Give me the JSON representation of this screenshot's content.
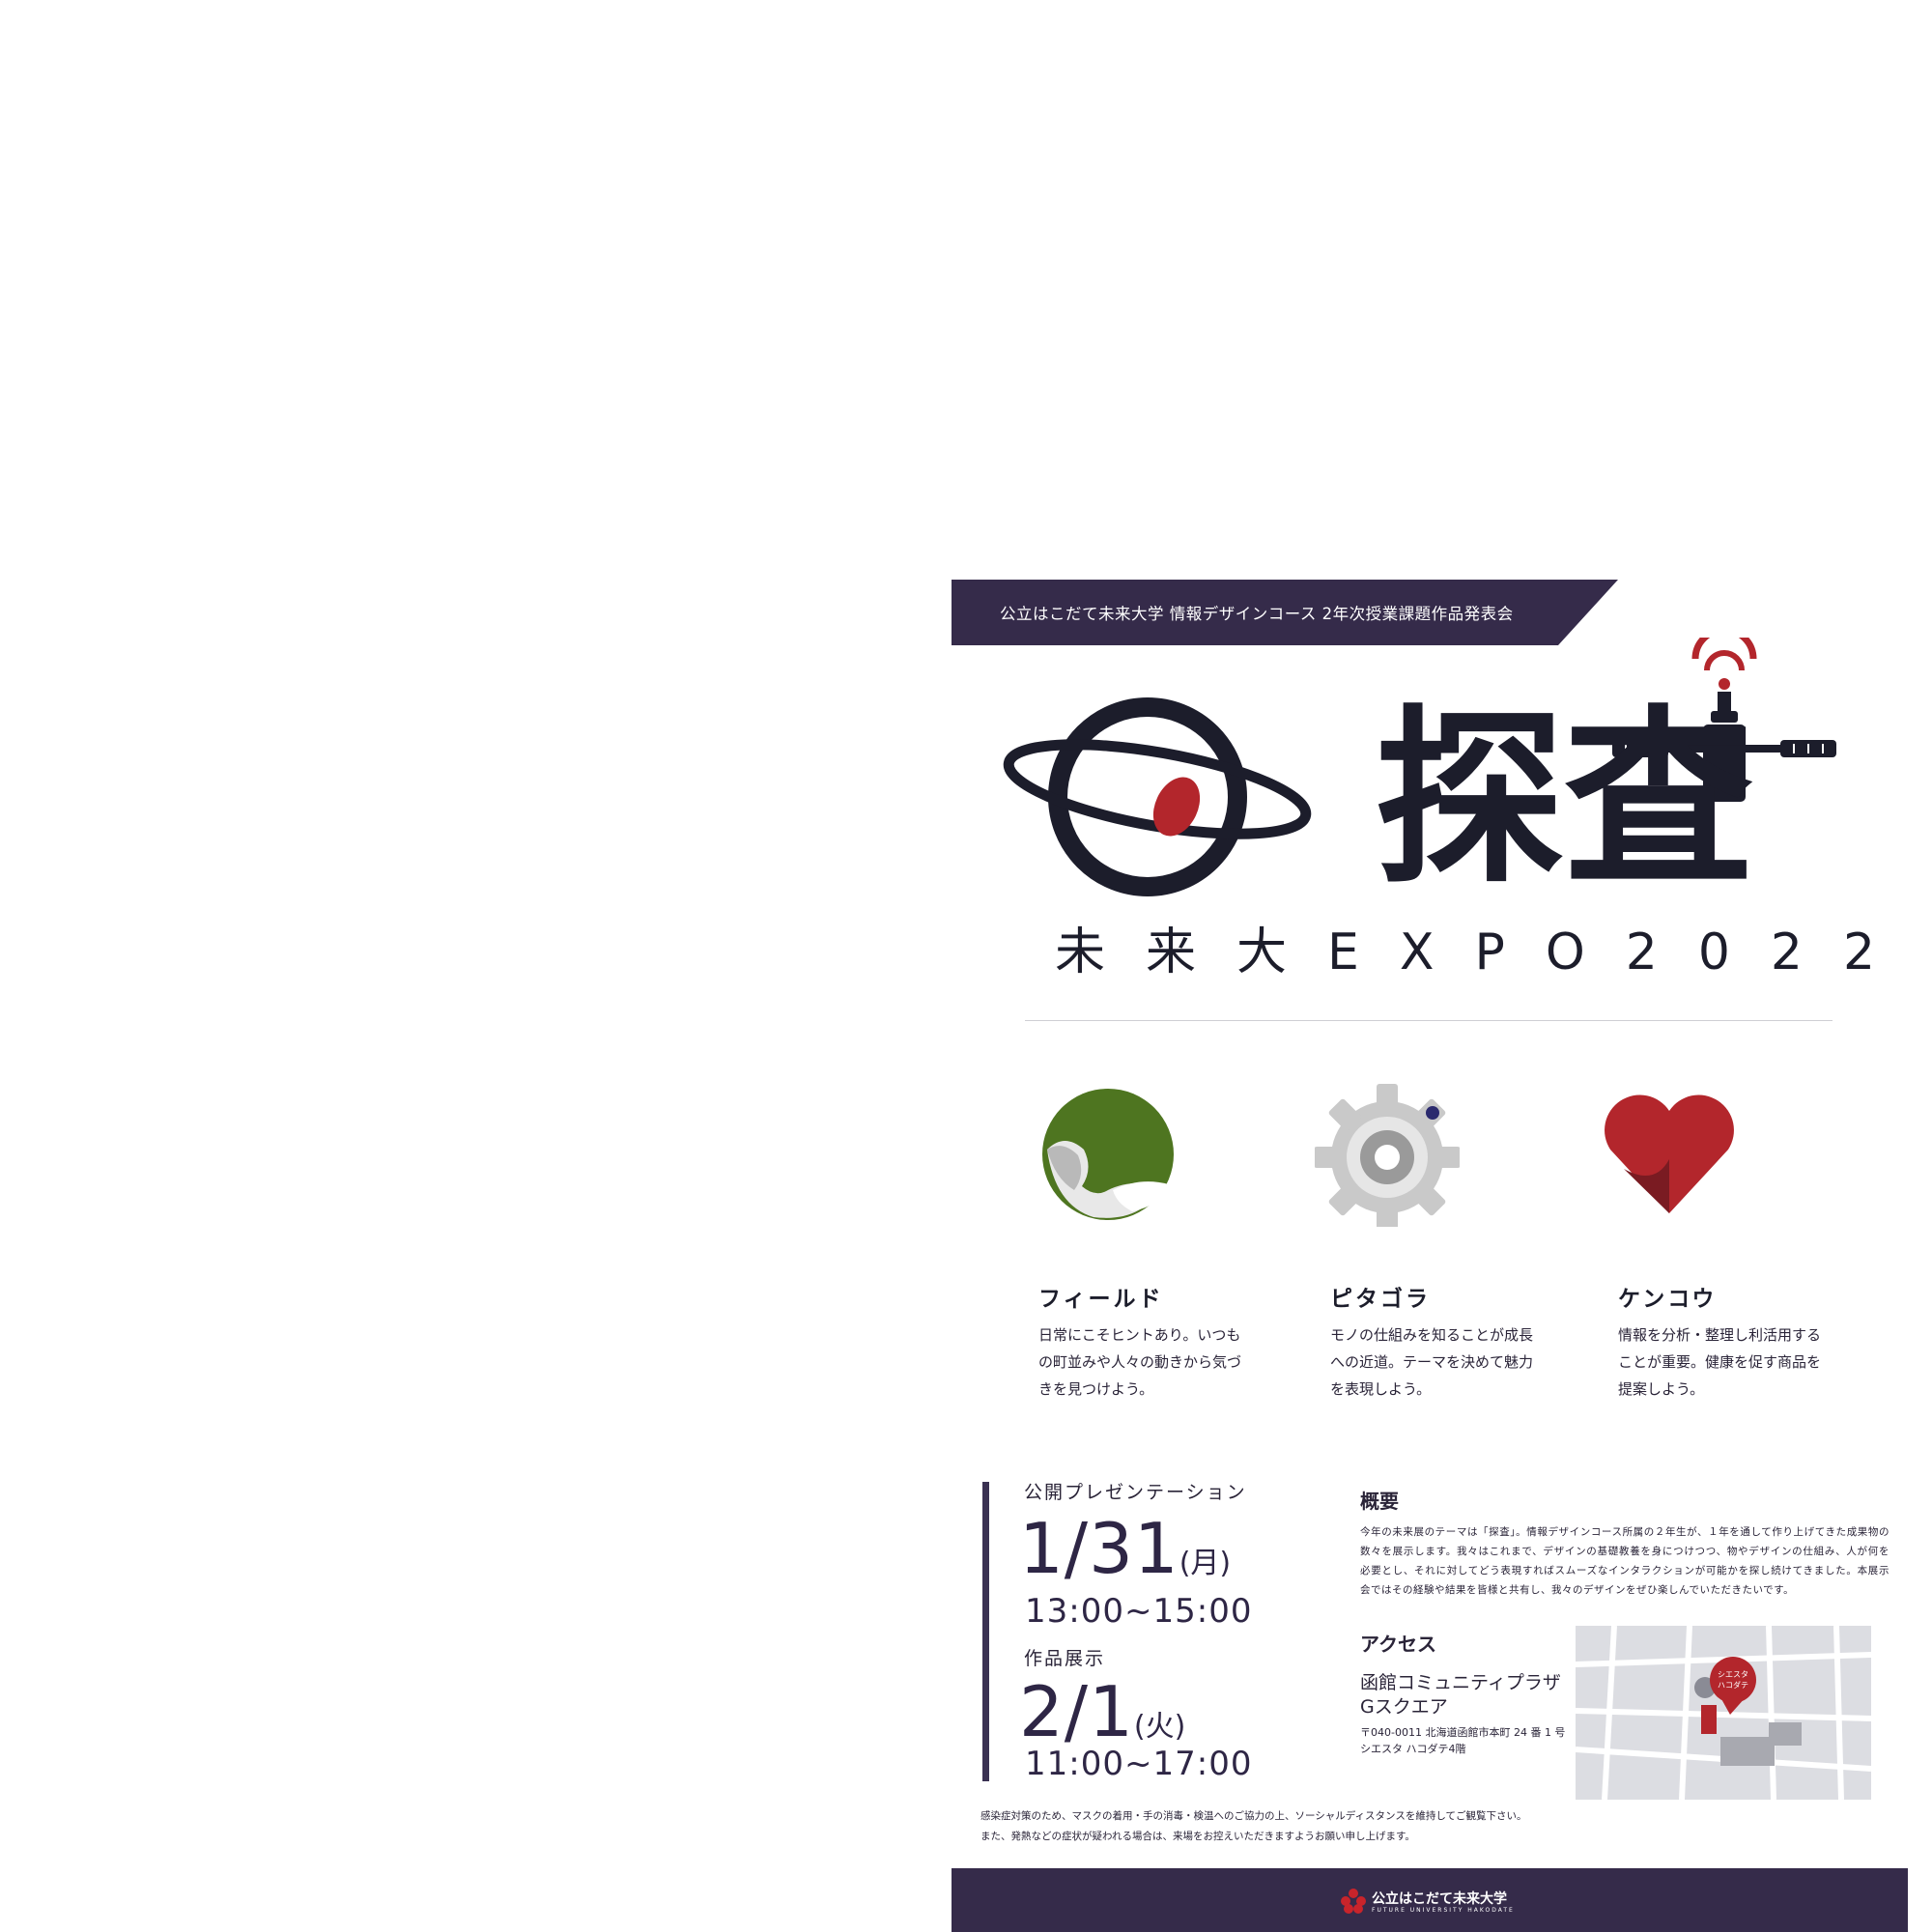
{
  "header": {
    "ribbon_text": "公立はこだて未来大学 情報デザインコース 2年次授業課題作品発表会"
  },
  "logo": {
    "title_kanji": "探査",
    "expo_text": "未来大EXPO2022"
  },
  "themes": [
    {
      "title": "フィールド",
      "description": "日常にこそヒントあり。いつもの町並みや人々の動きから気づきを見つけよう。"
    },
    {
      "title": "ピタゴラ",
      "description": "モノの仕組みを知ることが成長への近道。テーマを決めて魅力を表現しよう。"
    },
    {
      "title": "ケンコウ",
      "description": "情報を分析・整理し利活用することが重要。健康を促す商品を提案しよう。"
    }
  ],
  "schedule": {
    "presentation": {
      "label": "公開プレゼンテーション",
      "date": "1/31",
      "day": "(月)",
      "time": "13:00~15:00"
    },
    "exhibition": {
      "label": "作品展示",
      "date": "2/1",
      "day": "(火)",
      "time": "11:00~17:00"
    }
  },
  "overview": {
    "heading": "概要",
    "body": "今年の未来展のテーマは「探査」。情報デザインコース所属の２年生が、１年を通して作り上げてきた成果物の数々を展示します。我々はこれまで、デザインの基礎教養を身につけつつ、物やデザインの仕組み、人が何を必要とし、それに対してどう表現すればスムーズなインタラクションが可能かを探し続けてきました。本展示会ではその経験や結果を皆様と共有し、我々のデザインをぜひ楽しんでいただきたいです。"
  },
  "access": {
    "heading": "アクセス",
    "venue_line1": "函館コミュニティプラザ",
    "venue_line2": "Gスクエア",
    "address_line1": "〒040-0011 北海道函館市本町 24 番 1 号",
    "address_line2": "シエスタ ハコダテ4階",
    "map_pin_label": "シエスタ\nハコダテ"
  },
  "notice": {
    "line1": "感染症対策のため、マスクの着用・手の消毒・検温へのご協力の上、ソーシャルディスタンスを維持してご観覧下さい。",
    "line2": "また、発熱などの症状が疑われる場合は、来場をお控えいただきますようお願い申し上げます。"
  },
  "footer": {
    "university": "公立はこだて未来大学",
    "university_en": "FUTURE UNIVERSITY HAKODATE"
  },
  "colors": {
    "navy": "#352b4a",
    "ink": "#1c1d2b",
    "accent_red": "#b3262c",
    "leaf_green": "#4e7520",
    "gear_gray": "#c9c9c9"
  }
}
